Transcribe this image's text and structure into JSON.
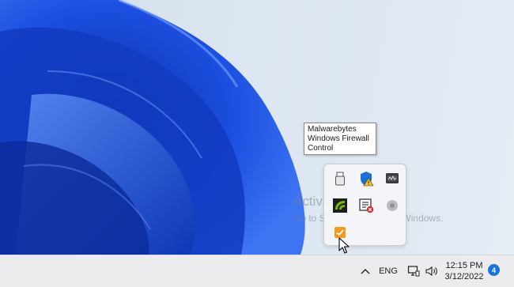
{
  "desktop": {
    "watermark": {
      "title": "Activate Windows",
      "subtitle": "Go to Settings to activate Windows."
    }
  },
  "tooltip": {
    "lines": [
      "Malwarebytes",
      "Windows Firewall",
      "Control"
    ]
  },
  "tray_overflow": {
    "icons": [
      "usb-device-icon",
      "windows-security-warning-icon",
      "monitor-app-icon",
      "nvidia-icon",
      "printer-error-icon",
      "round-gray-app-icon",
      "malwarebytes-firewall-control-icon"
    ]
  },
  "taskbar": {
    "language": "ENG",
    "time": "12:15 PM",
    "date": "3/12/2022",
    "notification_count": "4"
  },
  "colors": {
    "accent": "#1a73d9",
    "wallpaper_blue": "#1f4bd8",
    "firewall_orange": "#f29a1a"
  }
}
